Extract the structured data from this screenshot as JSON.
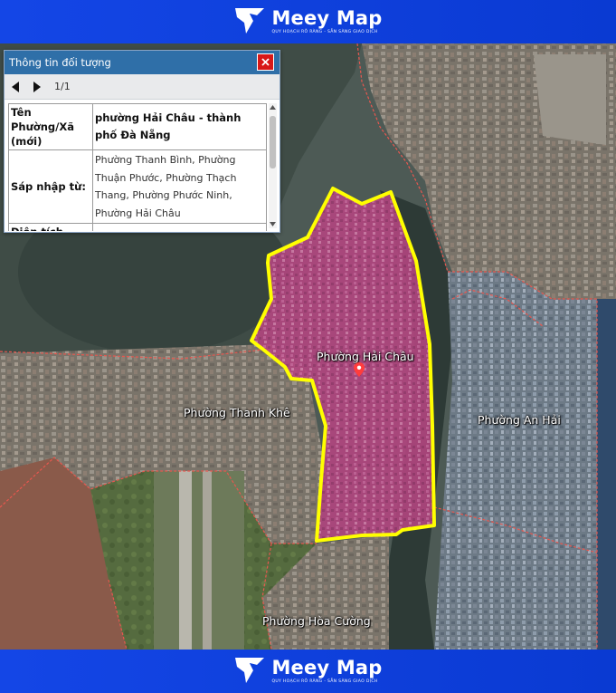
{
  "brand": {
    "name": "Meey Map",
    "tagline": "QUY HOẠCH RÕ RÀNG - SẴN SÀNG GIAO DỊCH",
    "color": "#0c3fd9"
  },
  "map": {
    "highlight_fill": "#c2458f",
    "highlight_stroke": "#ffff00",
    "boundary_color": "#e7574f",
    "labels": {
      "hai_chau": "Phường Hải Châu",
      "thanh_khe": "Phường Thanh Khê",
      "an_hai": "Phường An Hải",
      "hoa_cuong": "Phường Hòa Cường"
    },
    "marker_icon": "map-pin-icon"
  },
  "panel": {
    "title": "Thông tin đối tượng",
    "close_icon": "close-icon",
    "pager": {
      "prev_icon": "prev-icon",
      "next_icon": "next-icon",
      "count": "1/1"
    },
    "rows": [
      {
        "key": "Tên Phường/Xã (mới)",
        "value": "phường Hải Châu - thành phố Đà Nẵng"
      },
      {
        "key": "Sáp nhập từ:",
        "value": "Phường Thanh Bình, Phường Thuận Phước, Phường Thạch Thang, Phường Phước Ninh, Phường Hải Châu"
      },
      {
        "key": "Diện tích",
        "value": ""
      }
    ]
  }
}
